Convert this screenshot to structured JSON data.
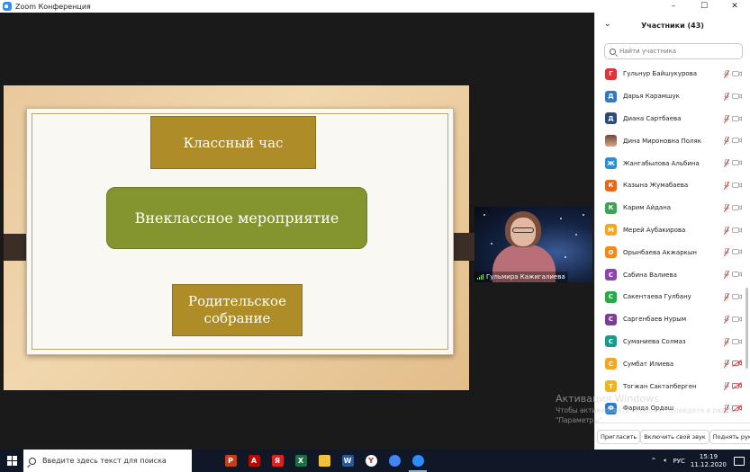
{
  "window": {
    "title": "Zoom Конференция",
    "minimize": "–",
    "maximize": "☐",
    "close": "✕"
  },
  "slide": {
    "box1": "Классный час",
    "box2": "Внеклассное мероприятие",
    "box3_line1": "Родительское",
    "box3_line2": "собрание"
  },
  "video": {
    "name": "Гульмира Кажигалиева"
  },
  "participants": {
    "title": "Участники (43)",
    "search_placeholder": "Найти участника",
    "items": [
      {
        "initial": "Г",
        "name": "Гульнур Байшукурова",
        "color": "#d9363e"
      },
      {
        "initial": "Д",
        "name": "Дарья Карамшук",
        "color": "#2f7ac4"
      },
      {
        "initial": "Д",
        "name": "Диана Сартбаева",
        "color": "#2e4a7a"
      },
      {
        "initial": "",
        "name": "Дина Мироновна Поляк",
        "color": "photo"
      },
      {
        "initial": "Ж",
        "name": "Жангабылова Альбина",
        "color": "#2b8fd8"
      },
      {
        "initial": "К",
        "name": "Казына Жумабаева",
        "color": "#e8671d"
      },
      {
        "initial": "К",
        "name": "Карим Айдана",
        "color": "#3aa655"
      },
      {
        "initial": "М",
        "name": "Мерей Аубакирова",
        "color": "#f5a623"
      },
      {
        "initial": "О",
        "name": "Орынбаева Акжаркын",
        "color": "#f08a18"
      },
      {
        "initial": "С",
        "name": "Сабина Валиева",
        "color": "#8e44ad"
      },
      {
        "initial": "С",
        "name": "Сакентаева Гулбану",
        "color": "#2aa84a"
      },
      {
        "initial": "С",
        "name": "Саргенбаев Нурым",
        "color": "#7d3c98"
      },
      {
        "initial": "С",
        "name": "Суманиева Солмаз",
        "color": "#1a9a8a"
      },
      {
        "initial": "С",
        "name": "Сумбат Илиева",
        "color": "#f5a623"
      },
      {
        "initial": "Т",
        "name": "Тогжан Сактапберген",
        "color": "#f0b41e"
      },
      {
        "initial": "Ф",
        "name": "Фарида Ордаш",
        "color": "#2f7ac4"
      }
    ],
    "invite": "Пригласить",
    "unmute": "Включить свой звук",
    "raise_hand": "Поднять руку"
  },
  "watermark": {
    "title": "Активация Windows",
    "line1": "Чтобы активировать Windows, перейдите в раздел",
    "line2": "\"Параметры\"."
  },
  "taskbar": {
    "search_placeholder": "Введите здесь текст для поиска",
    "lang": "РУС",
    "time": "15:19",
    "date": "11.12.2020",
    "apps": [
      {
        "name": "powerpoint-icon",
        "label": "P",
        "color": "#c43e1c"
      },
      {
        "name": "acrobat-icon",
        "label": "A",
        "color": "#b30b00"
      },
      {
        "name": "yandex-icon",
        "label": "Я",
        "color": "#e02020"
      },
      {
        "name": "excel-icon",
        "label": "X",
        "color": "#1d6f42"
      },
      {
        "name": "file-explorer-icon",
        "label": "",
        "color": "#f3c13a"
      },
      {
        "name": "word-icon",
        "label": "W",
        "color": "#2b579a"
      },
      {
        "name": "yandex-browser-icon",
        "label": "Y",
        "color": "#ffffff"
      },
      {
        "name": "chrome-icon",
        "label": "",
        "color": "#4285f4"
      },
      {
        "name": "zoom-icon",
        "label": "",
        "color": "#2d8cff"
      }
    ]
  }
}
